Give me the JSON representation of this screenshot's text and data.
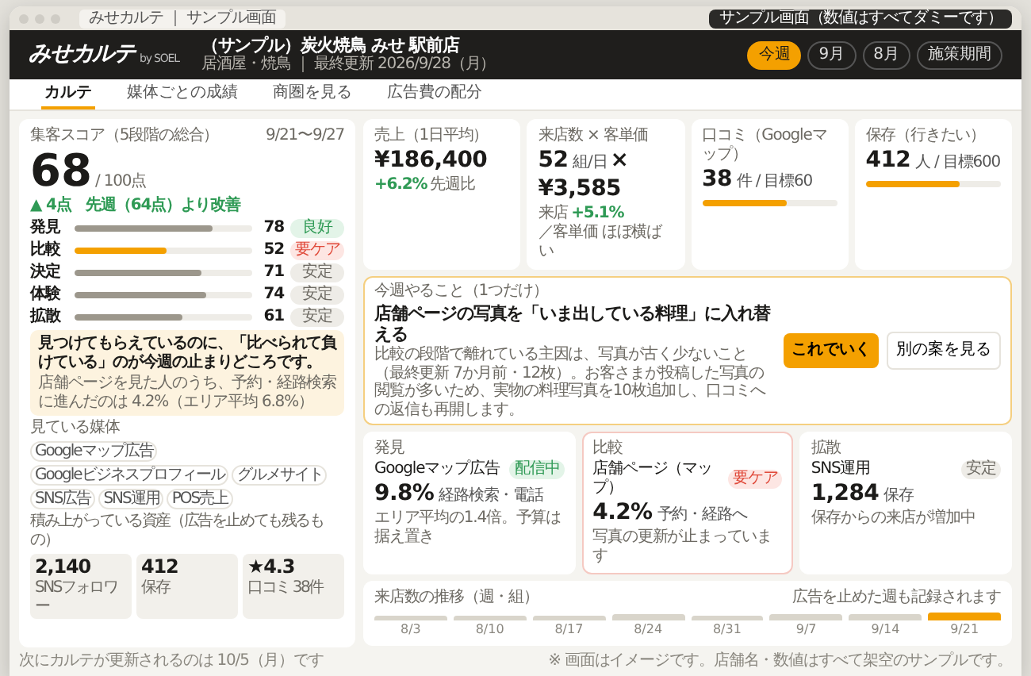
{
  "browser": {
    "tab": "みせカルテ ｜ サンプル画面",
    "badge": "サンプル画面（数値はすべてダミーです）"
  },
  "header": {
    "logo": "みせカルテ",
    "logo_by": "by SOEL",
    "store": "（サンプル）炭火焼鳥 みせ 駅前店",
    "subtitle": "居酒屋・焼鳥 ｜ 最終更新 2026/9/28（月）",
    "periods": [
      {
        "label": "今週",
        "selected": true
      },
      {
        "label": "9月",
        "selected": false
      },
      {
        "label": "8月",
        "selected": false
      },
      {
        "label": "施策期間",
        "selected": false
      }
    ]
  },
  "tabs": [
    {
      "label": "カルテ",
      "selected": true
    },
    {
      "label": "媒体ごとの成績",
      "selected": false
    },
    {
      "label": "商圏を見る",
      "selected": false
    },
    {
      "label": "広告費の配分",
      "selected": false
    }
  ],
  "score": {
    "label": "集客スコア（5段階の総合）",
    "range": "9/21〜9/27",
    "value": "68",
    "max": "/ 100点",
    "delta": "▲ 4点　先週（64点）より改善",
    "rows": [
      {
        "name": "発見",
        "level": 0.78,
        "value": "78",
        "status": "良好",
        "kind": "good"
      },
      {
        "name": "比較",
        "level": 0.52,
        "value": "52",
        "status": "要ケア",
        "kind": "care"
      },
      {
        "name": "決定",
        "level": 0.71,
        "value": "71",
        "status": "安定",
        "kind": "neutral"
      },
      {
        "name": "体験",
        "level": 0.74,
        "value": "74",
        "status": "安定",
        "kind": "neutral"
      },
      {
        "name": "拡散",
        "level": 0.61,
        "value": "61",
        "status": "安定",
        "kind": "neutral"
      }
    ],
    "callout": {
      "headline": "見つけてもらえているのに、**「比べられて負けている」**のが今週の止まりどころです。",
      "body": "店舗ページを見た人のうち、予約・経路検索に進んだのは 4.2%（エリア平均 6.8%）"
    },
    "media_label": "見ている媒体",
    "media": [
      "Googleマップ広告",
      "Googleビジネスプロフィール",
      "グルメサイト",
      "SNS広告",
      "SNS運用",
      "POS売上"
    ],
    "assets_label": "積み上がっている資産（広告を止めても残るもの）",
    "assets": [
      {
        "value": "2,140",
        "label": "SNSフォロワー"
      },
      {
        "value": "412",
        "label": "保存"
      },
      {
        "value": "★4.3",
        "label": "口コミ 38件"
      }
    ],
    "footer": "次にカルテが更新されるのは 10/5（月）です"
  },
  "kpis": [
    {
      "kind": "plain",
      "label": "売上（1日平均）",
      "value": "¥186,400",
      "delta": "+6.2%",
      "note": "先週比"
    },
    {
      "kind": "ratio",
      "label": "来店数 × 客単価",
      "value": "52",
      "unit": "組/日",
      "operator": "×",
      "value2": "¥3,585",
      "note_lead": "来店",
      "delta": "+5.1%",
      "note": "／客単価 ほぼ横ばい"
    },
    {
      "kind": "progress",
      "label": "口コミ（Googleマップ）",
      "value": "38",
      "unit": "件 / 目標60",
      "level": 0.63
    },
    {
      "kind": "progress",
      "label": "保存（行きたい）",
      "value": "412",
      "unit": "人 / 目標600",
      "level": 0.69
    }
  ],
  "action": {
    "label": "今週やること（1つだけ）",
    "title": "店舗ページの写真を「いま出している料理」に入れ替える",
    "body": "比較の段階で離れている主因は、写真が古く少ないこと（最終更新 7か月前・12枚）。お客さまが投稿した写真の閲覧が多いため、実物の料理写真を10枚追加し、口コミへの返信も再開します。",
    "primary": "これでいく",
    "secondary": "別の案を見る"
  },
  "channels": [
    {
      "stage": "発見",
      "name": "Googleマップ広告",
      "status": "配信中",
      "kind": "good",
      "value": "9.8%",
      "unit": "経路検索・電話",
      "note": "エリア平均の1.4倍。予算は据え置き",
      "alert": false
    },
    {
      "stage": "比較",
      "name": "店舗ページ（マップ）",
      "status": "要ケア",
      "kind": "care",
      "value": "4.2%",
      "unit": "予約・経路へ",
      "note": "写真の更新が止まっています",
      "alert": true
    },
    {
      "stage": "拡散",
      "name": "SNS運用",
      "status": "安定",
      "kind": "neutral",
      "value": "1,284",
      "unit": "保存",
      "note": "保存からの来店が増加中",
      "alert": false
    }
  ],
  "visits": {
    "title": "来店数の推移（週・組）",
    "note": "広告を止めた週も記録されます",
    "bars": [
      {
        "label": "8/3",
        "selected": false
      },
      {
        "label": "8/10",
        "selected": false
      },
      {
        "label": "8/17",
        "selected": false
      },
      {
        "label": "8/24",
        "selected": false
      },
      {
        "label": "8/31",
        "selected": false
      },
      {
        "label": "9/7",
        "selected": false
      },
      {
        "label": "9/14",
        "selected": false
      },
      {
        "label": "9/21",
        "selected": true
      }
    ]
  },
  "disclaimer": "※ 画面はイメージです。店舗名・数値はすべて架空のサンプルです。"
}
